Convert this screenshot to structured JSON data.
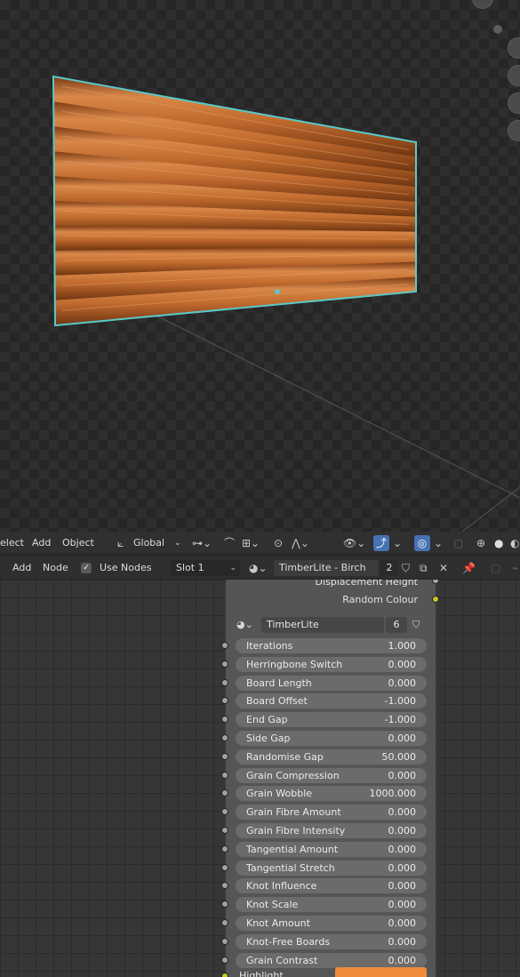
{
  "header_viewport": {
    "select_label": "elect",
    "add_label": "Add",
    "object_label": "Object",
    "orientation_label": "Global"
  },
  "header_node": {
    "add_label": "Add",
    "node_label": "Node",
    "use_nodes_label": "Use Nodes",
    "slot_label": "Slot 1",
    "material_name": "TimberLite - Birch Ply",
    "user_count": "2"
  },
  "node": {
    "outputs": [
      "Displacement Height",
      "Random Colour"
    ],
    "group_name": "TimberLite",
    "group_users": "6",
    "inputs": [
      {
        "label": "Iterations",
        "value": "1.000"
      },
      {
        "label": "Herringbone Switch",
        "value": "0.000"
      },
      {
        "label": "Board Length",
        "value": "0.000"
      },
      {
        "label": "Board Offset",
        "value": "-1.000"
      },
      {
        "label": "End Gap",
        "value": "-1.000"
      },
      {
        "label": "Side Gap",
        "value": "0.000"
      },
      {
        "label": "Randomise Gap",
        "value": "50.000"
      },
      {
        "label": "Grain Compression",
        "value": "0.000"
      },
      {
        "label": "Grain Wobble",
        "value": "1000.000"
      },
      {
        "label": "Grain Fibre Amount",
        "value": "0.000"
      },
      {
        "label": "Grain Fibre Intensity",
        "value": "0.000"
      },
      {
        "label": "Tangential Amount",
        "value": "0.000"
      },
      {
        "label": "Tangential Stretch",
        "value": "0.000"
      },
      {
        "label": "Knot Influence",
        "value": "0.000"
      },
      {
        "label": "Knot Scale",
        "value": "0.000"
      },
      {
        "label": "Knot Amount",
        "value": "0.000"
      },
      {
        "label": "Knot-Free Boards",
        "value": "0.000"
      },
      {
        "label": "Grain Contrast",
        "value": "0.000"
      }
    ],
    "highlight_label": "Highlight",
    "highlight_color": "#f08a3a"
  },
  "colors": {
    "selection_outline": "#5bc8c8",
    "active_button": "#4772b3",
    "wood": "#b8622a"
  }
}
